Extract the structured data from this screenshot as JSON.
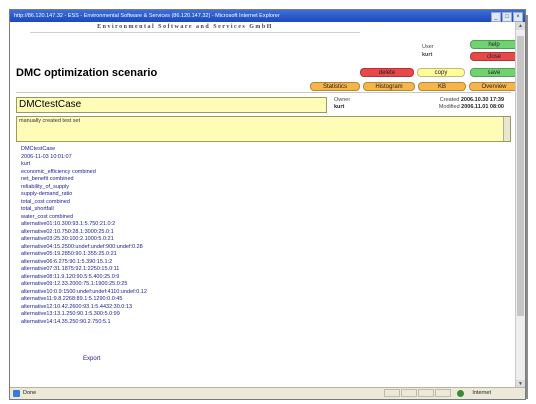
{
  "browser": {
    "title_bar": "http://86.120.147.32 - ESS - Environmental Software & Services (86.120.147.32) - Microsoft Internet Explorer",
    "window_buttons": {
      "minimize": "_",
      "maximize": "□",
      "close": "×"
    },
    "status_text": "Done",
    "zone_text": "Internet"
  },
  "header": {
    "company": "Environmental Software and Services GmbH",
    "page_title": "DMC optimization scenario",
    "user_label": "User",
    "user_name": "kurt"
  },
  "buttons": {
    "help": "help",
    "close": "close",
    "delete": "delete",
    "copy": "copy",
    "save": "save",
    "statistics": "Statistics",
    "histogram": "Histogram",
    "kb": "KB",
    "overview": "Overview"
  },
  "colors": {
    "help": "#6fd36f",
    "close": "#e84848",
    "delete": "#e84848",
    "copy": "#fffc9c",
    "save": "#6fd36f",
    "tab": "#f5b54a"
  },
  "case": {
    "name": "DMCtestCase",
    "owner_label": "Owner",
    "owner": "kurt",
    "created_label": "Created",
    "created": "2006.10.30 17:39",
    "modified_label": "Modified",
    "modified": "2006.11.01 08:00",
    "description": "manually created test set"
  },
  "data_lines": [
    "DMCtestCase",
    "2006-11-03 10:01:07",
    "kurt",
    "economic_efficiency combined",
    "net_benefit combined",
    "reliability_of_supply",
    "supply-demand_ratio",
    "total_cost combined",
    "total_shortfall",
    "water_cost combined",
    "alternative01:10.300:93.1:5.750:21.0:2",
    "alternative02:10.750:28.1:3000:25.0:1",
    "alternative03:25.30:100:2.1000:5.0:21",
    "alternative04:15.2500:undef:undef:900:undef:0.28",
    "alternative05:19.2850:90.1:355:25.0:21",
    "alternative06:6.275:90.1:5.390:15.1:2",
    "alternative07:31.1875:92.1:2250:15.0:11",
    "alternative08:11.9.120:90.5:5.400:25.0:9",
    "alternative09:12.33.2000:75.1:1900:25.0:25",
    "alternative10:0.9:1500:undef:undef:4110:undef:0.12",
    "alternative11:9.8.2268:89.1:5.1290:0.0:45",
    "alternative12:10.42.2600:93.1:5.4432:30.0:13",
    "alternative13:13.1.250:90.1:5.300:5.0:99",
    "alternative14:14.35.250:90.2.750:5.1"
  ],
  "export_label": "Export"
}
